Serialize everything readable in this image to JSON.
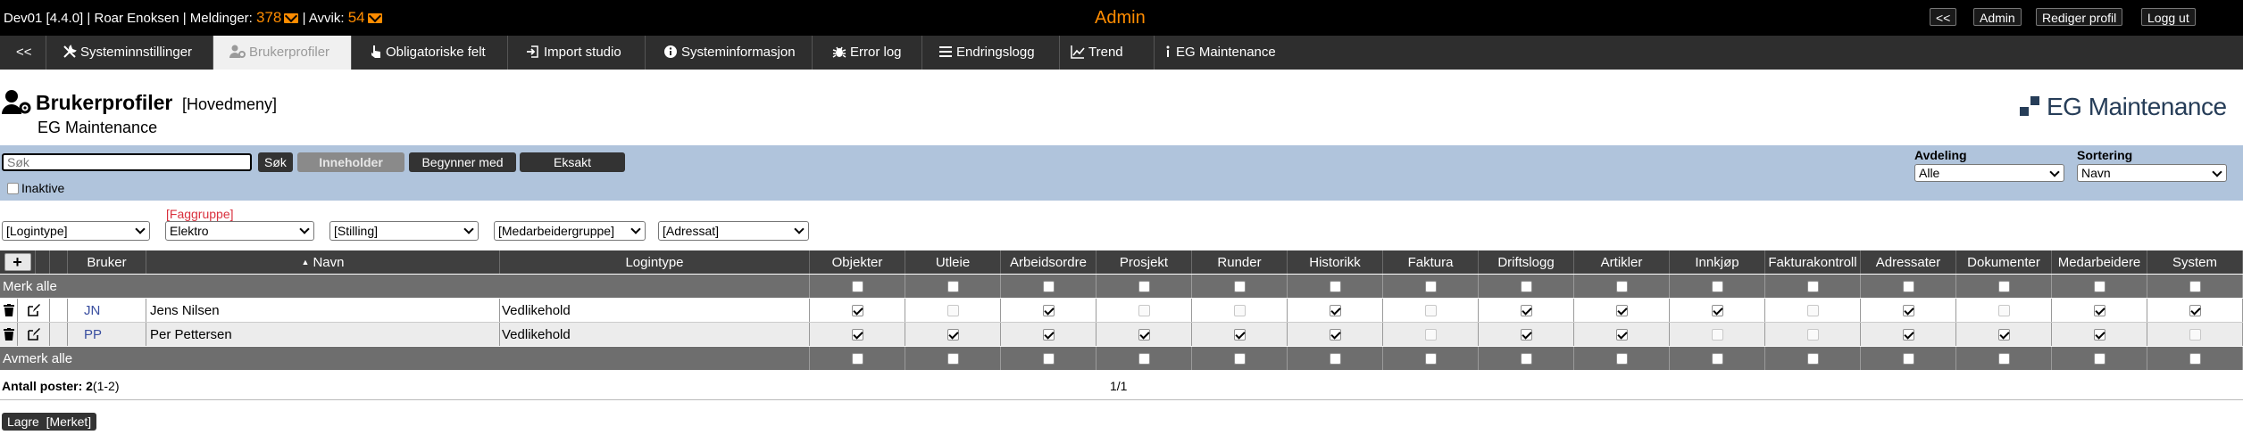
{
  "topbar": {
    "env": "Dev01 [4.4.0]",
    "sep1": "|",
    "user": "Roar Enoksen",
    "sep2": "|",
    "messages_label": "Meldinger:",
    "messages_count": "378",
    "sep3": "|",
    "deviations_label": "Avvik:",
    "deviations_count": "54",
    "center_title": "Admin",
    "buttons": {
      "back": "<<",
      "admin": "Admin",
      "edit_profile": "Rediger profil",
      "logout": "Logg ut"
    }
  },
  "tabs": [
    {
      "label": "<<",
      "icon": ""
    },
    {
      "label": "Systeminnstillinger",
      "icon": "tools-icon"
    },
    {
      "label": "Brukerprofiler",
      "icon": "user-gear-icon"
    },
    {
      "label": "Obligatoriske felt",
      "icon": "pointer-icon"
    },
    {
      "label": "Import studio",
      "icon": "import-icon"
    },
    {
      "label": "Systeminformasjon",
      "icon": "info-circle-icon"
    },
    {
      "label": "Error log",
      "icon": "bug-icon"
    },
    {
      "label": "Endringslogg",
      "icon": "list-icon"
    },
    {
      "label": "Trend",
      "icon": "chart-line-icon"
    },
    {
      "label": "EG Maintenance",
      "icon": "info-icon"
    }
  ],
  "page": {
    "title": "Brukerprofiler",
    "title_suffix": "[Hovedmeny]",
    "subtitle": "EG Maintenance",
    "logo_text": "EG Maintenance"
  },
  "search": {
    "placeholder": "Søk",
    "search_btn": "Søk",
    "contains_btn": "Inneholder",
    "starts_btn": "Begynner med",
    "exact_btn": "Eksakt",
    "inactive_label": "Inaktive",
    "department_label": "Avdeling",
    "department_value": "Alle",
    "sort_label": "Sortering",
    "sort_value": "Navn"
  },
  "filters": {
    "faggruppe_label": "[Faggruppe]",
    "logintype": "[Logintype]",
    "faggruppe": "Elektro",
    "stilling": "[Stilling]",
    "medarbeidergruppe": "[Medarbeidergruppe]",
    "adressat": "[Adressat]"
  },
  "table": {
    "add_label": "+",
    "headers": {
      "bruker": "Bruker",
      "navn": "Navn",
      "sort_icon": "sort-up-icon",
      "logintype": "Logintype"
    },
    "modules": [
      "Objekter",
      "Utleie",
      "Arbeidsordre",
      "Prosjekt",
      "Runder",
      "Historikk",
      "Faktura",
      "Driftslogg",
      "Artikler",
      "Innkjøp",
      "Fakturakontroll",
      "Adressater",
      "Dokumenter",
      "Medarbeidere",
      "System"
    ],
    "select_all": "Merk alle",
    "deselect_all": "Avmerk alle",
    "rows": [
      {
        "abbr": "JN",
        "name": "Jens Nilsen",
        "logintype": "Vedlikehold",
        "perms": [
          true,
          false,
          true,
          false,
          false,
          true,
          false,
          true,
          true,
          true,
          false,
          true,
          false,
          true,
          true
        ],
        "disabled": [
          false,
          true,
          false,
          true,
          true,
          false,
          true,
          false,
          false,
          false,
          true,
          false,
          true,
          false,
          false
        ]
      },
      {
        "abbr": "PP",
        "name": "Per Pettersen",
        "logintype": "Vedlikehold",
        "perms": [
          true,
          true,
          true,
          true,
          true,
          true,
          false,
          true,
          true,
          false,
          false,
          true,
          true,
          true,
          false
        ],
        "disabled": [
          false,
          false,
          false,
          false,
          false,
          false,
          true,
          false,
          false,
          true,
          true,
          false,
          false,
          false,
          true
        ]
      }
    ]
  },
  "footer": {
    "count_label": "Antall poster:",
    "count_value": "2",
    "count_range": "(1-2)",
    "pager": "1/1",
    "save_btn": "Lagre  [Merket]"
  },
  "colors": {
    "accent": "#ff8c00",
    "band": "#b0c4dc",
    "faggruppe_label": "#d9303d",
    "logo": "#263d58"
  }
}
